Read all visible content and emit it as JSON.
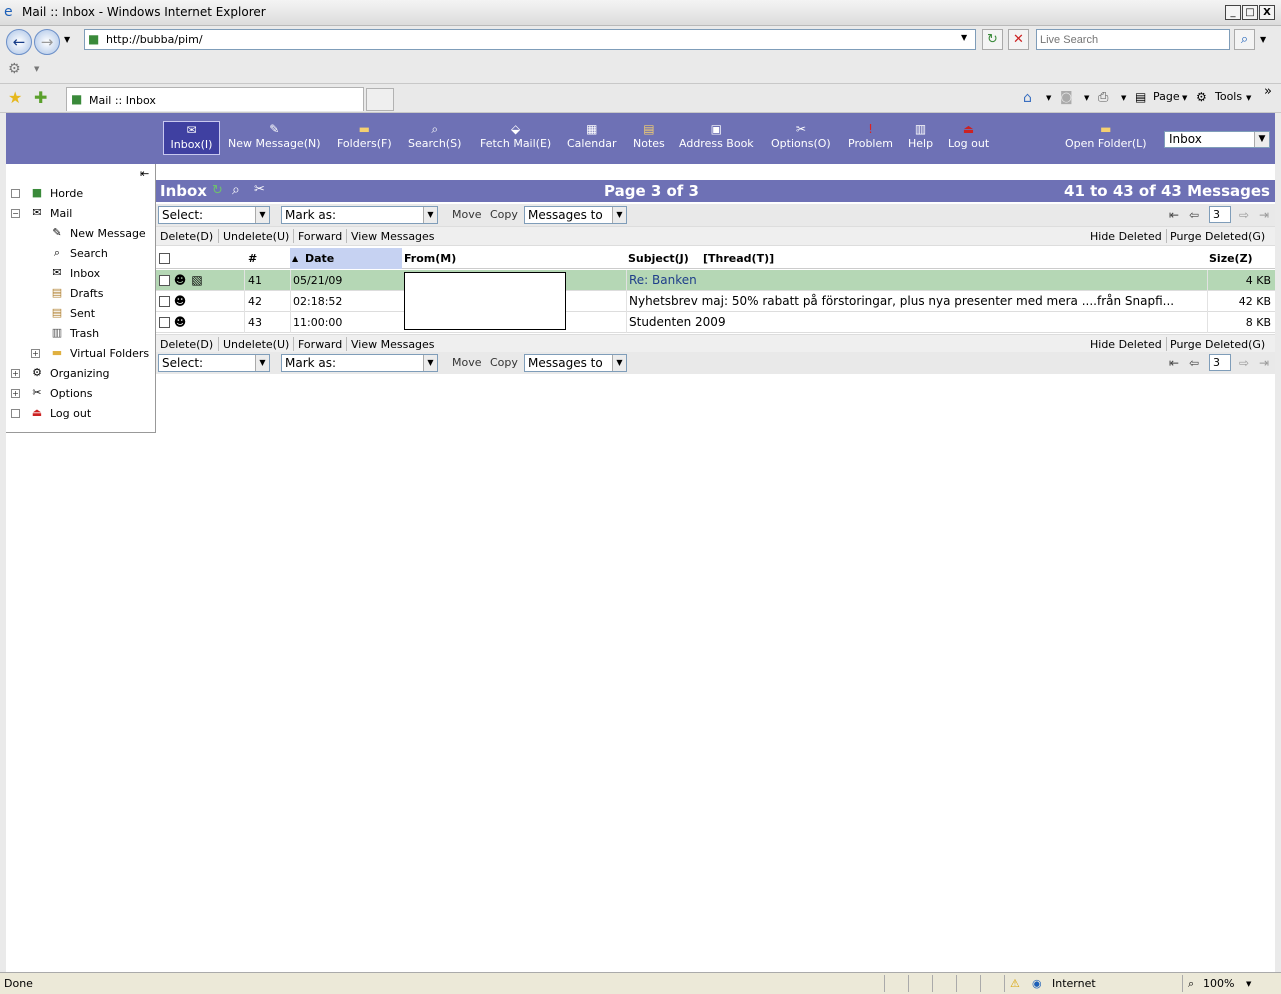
{
  "window": {
    "title": "Mail :: Inbox - Windows Internet Explorer",
    "min": "_",
    "max": "□",
    "close": "X"
  },
  "address": {
    "url": "http://bubba/pim/",
    "search_placeholder": "Live Search"
  },
  "tab": {
    "label": "Mail :: Inbox"
  },
  "commandbar": {
    "page": "Page",
    "tools": "Tools"
  },
  "horde_menu": {
    "inbox": "Inbox(I)",
    "new_message": "New Message(N)",
    "folders": "Folders(F)",
    "search": "Search(S)",
    "fetch_mail": "Fetch Mail(E)",
    "calendar": "Calendar",
    "notes": "Notes",
    "address_book": "Address Book",
    "options": "Options(O)",
    "problem": "Problem",
    "help": "Help",
    "logout": "Log out",
    "open_folder": "Open Folder(L)",
    "folder_select": "Inbox"
  },
  "sidebar": {
    "horde": "Horde",
    "mail": "Mail",
    "new_message": "New Message",
    "search": "Search",
    "inbox": "Inbox",
    "drafts": "Drafts",
    "sent": "Sent",
    "trash": "Trash",
    "virtual_folders": "Virtual Folders",
    "organizing": "Organizing",
    "options": "Options",
    "logout": "Log out"
  },
  "mailbox": {
    "title": "Inbox",
    "page": "Page 3 of 3",
    "range": "41 to 43 of 43 Messages",
    "select_label": "Select:",
    "mark_label": "Mark as:",
    "move": "Move",
    "copy": "Copy",
    "messages_to": "Messages to",
    "page_number": "3",
    "delete": "Delete(D)",
    "undelete": "Undelete(U)",
    "forward": "Forward",
    "view_messages": "View Messages",
    "hide_deleted": "Hide Deleted",
    "purge_deleted": "Purge Deleted(G)"
  },
  "columns": {
    "num": "#",
    "date": "Date",
    "from": "From(M)",
    "subject": "Subject(J)",
    "thread": "[Thread(T)]",
    "size": "Size(Z)"
  },
  "messages": [
    {
      "num": "41",
      "date": "05/21/09",
      "subject": "Re: Banken",
      "size": "4 KB"
    },
    {
      "num": "42",
      "date": "02:18:52",
      "subject": "Nyhetsbrev maj: 50% rabatt på förstoringar, plus nya presenter med mera ....från Snapfi...",
      "size": "42 KB"
    },
    {
      "num": "43",
      "date": "11:00:00",
      "subject": "Studenten 2009",
      "size": "8 KB"
    }
  ],
  "statusbar": {
    "text": "Done",
    "zone": "Internet",
    "zoom": "100%"
  },
  "colors": {
    "horde_bar": "#6e71b5",
    "active_button": "#3f40a1",
    "highlight_row": "#b5d7b5",
    "link": "#1f3e8a"
  }
}
